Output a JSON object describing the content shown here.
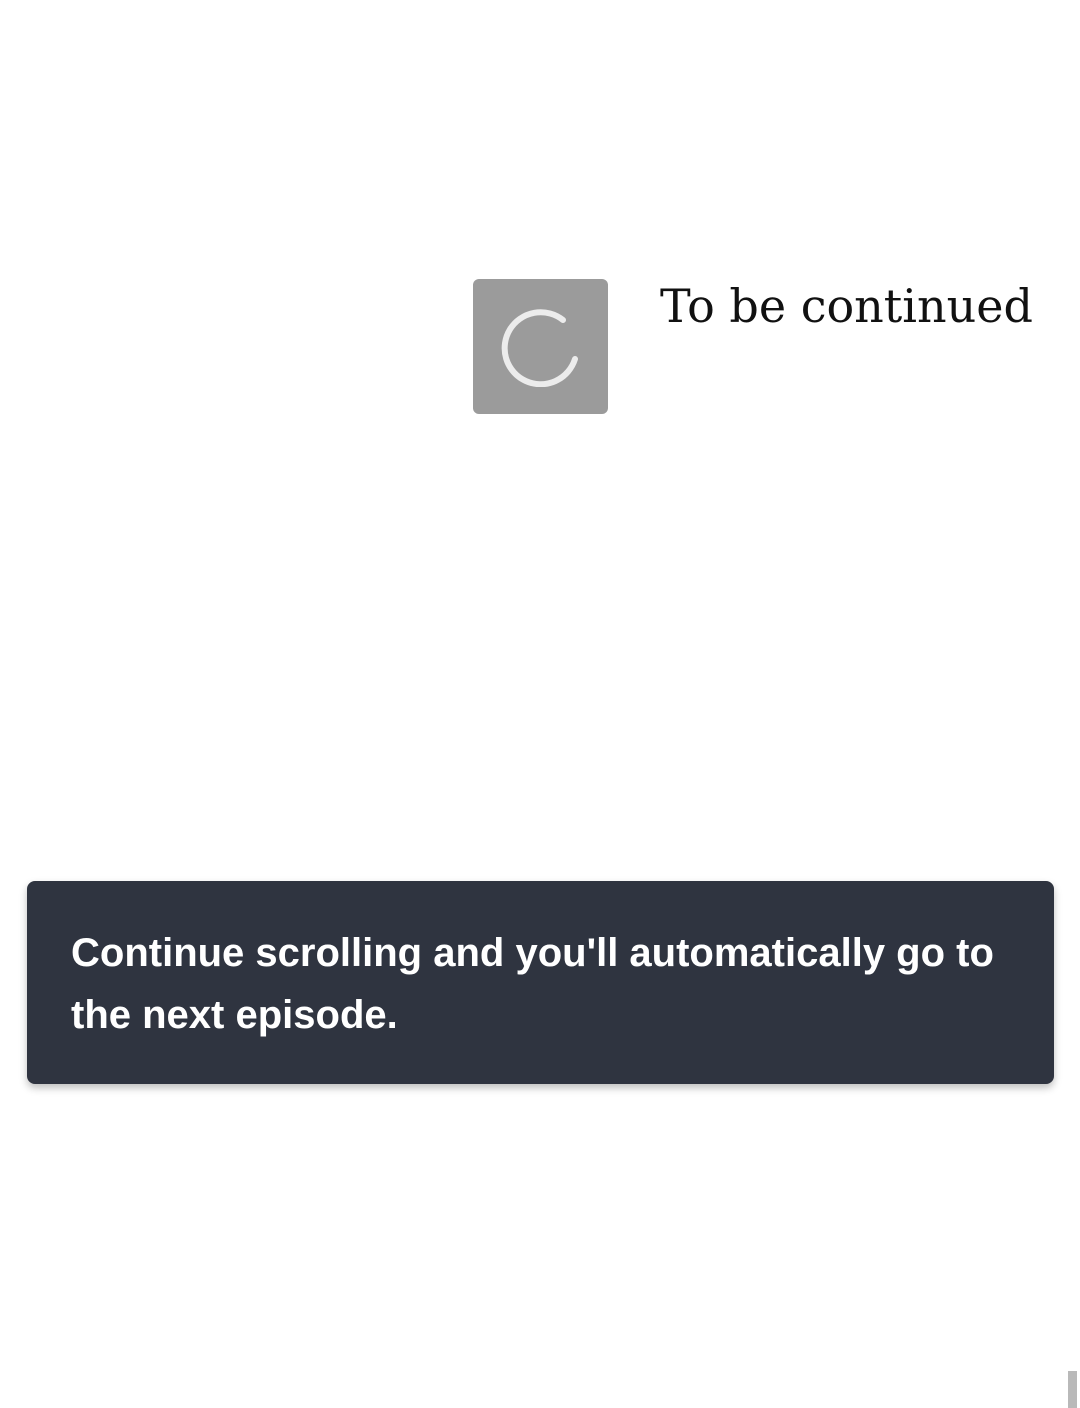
{
  "end_card": {
    "thumbnail_icon": "loading-spinner-icon",
    "title": "To be continued"
  },
  "toast": {
    "message": "Continue scrolling and you'll automatically go to the next episode."
  },
  "colors": {
    "page_background": "#ffffff",
    "thumbnail_placeholder": "#9b9b9b",
    "spinner": "#ececec",
    "toast_background": "#2f3440",
    "toast_text": "#ffffff",
    "title_text": "#111111"
  }
}
